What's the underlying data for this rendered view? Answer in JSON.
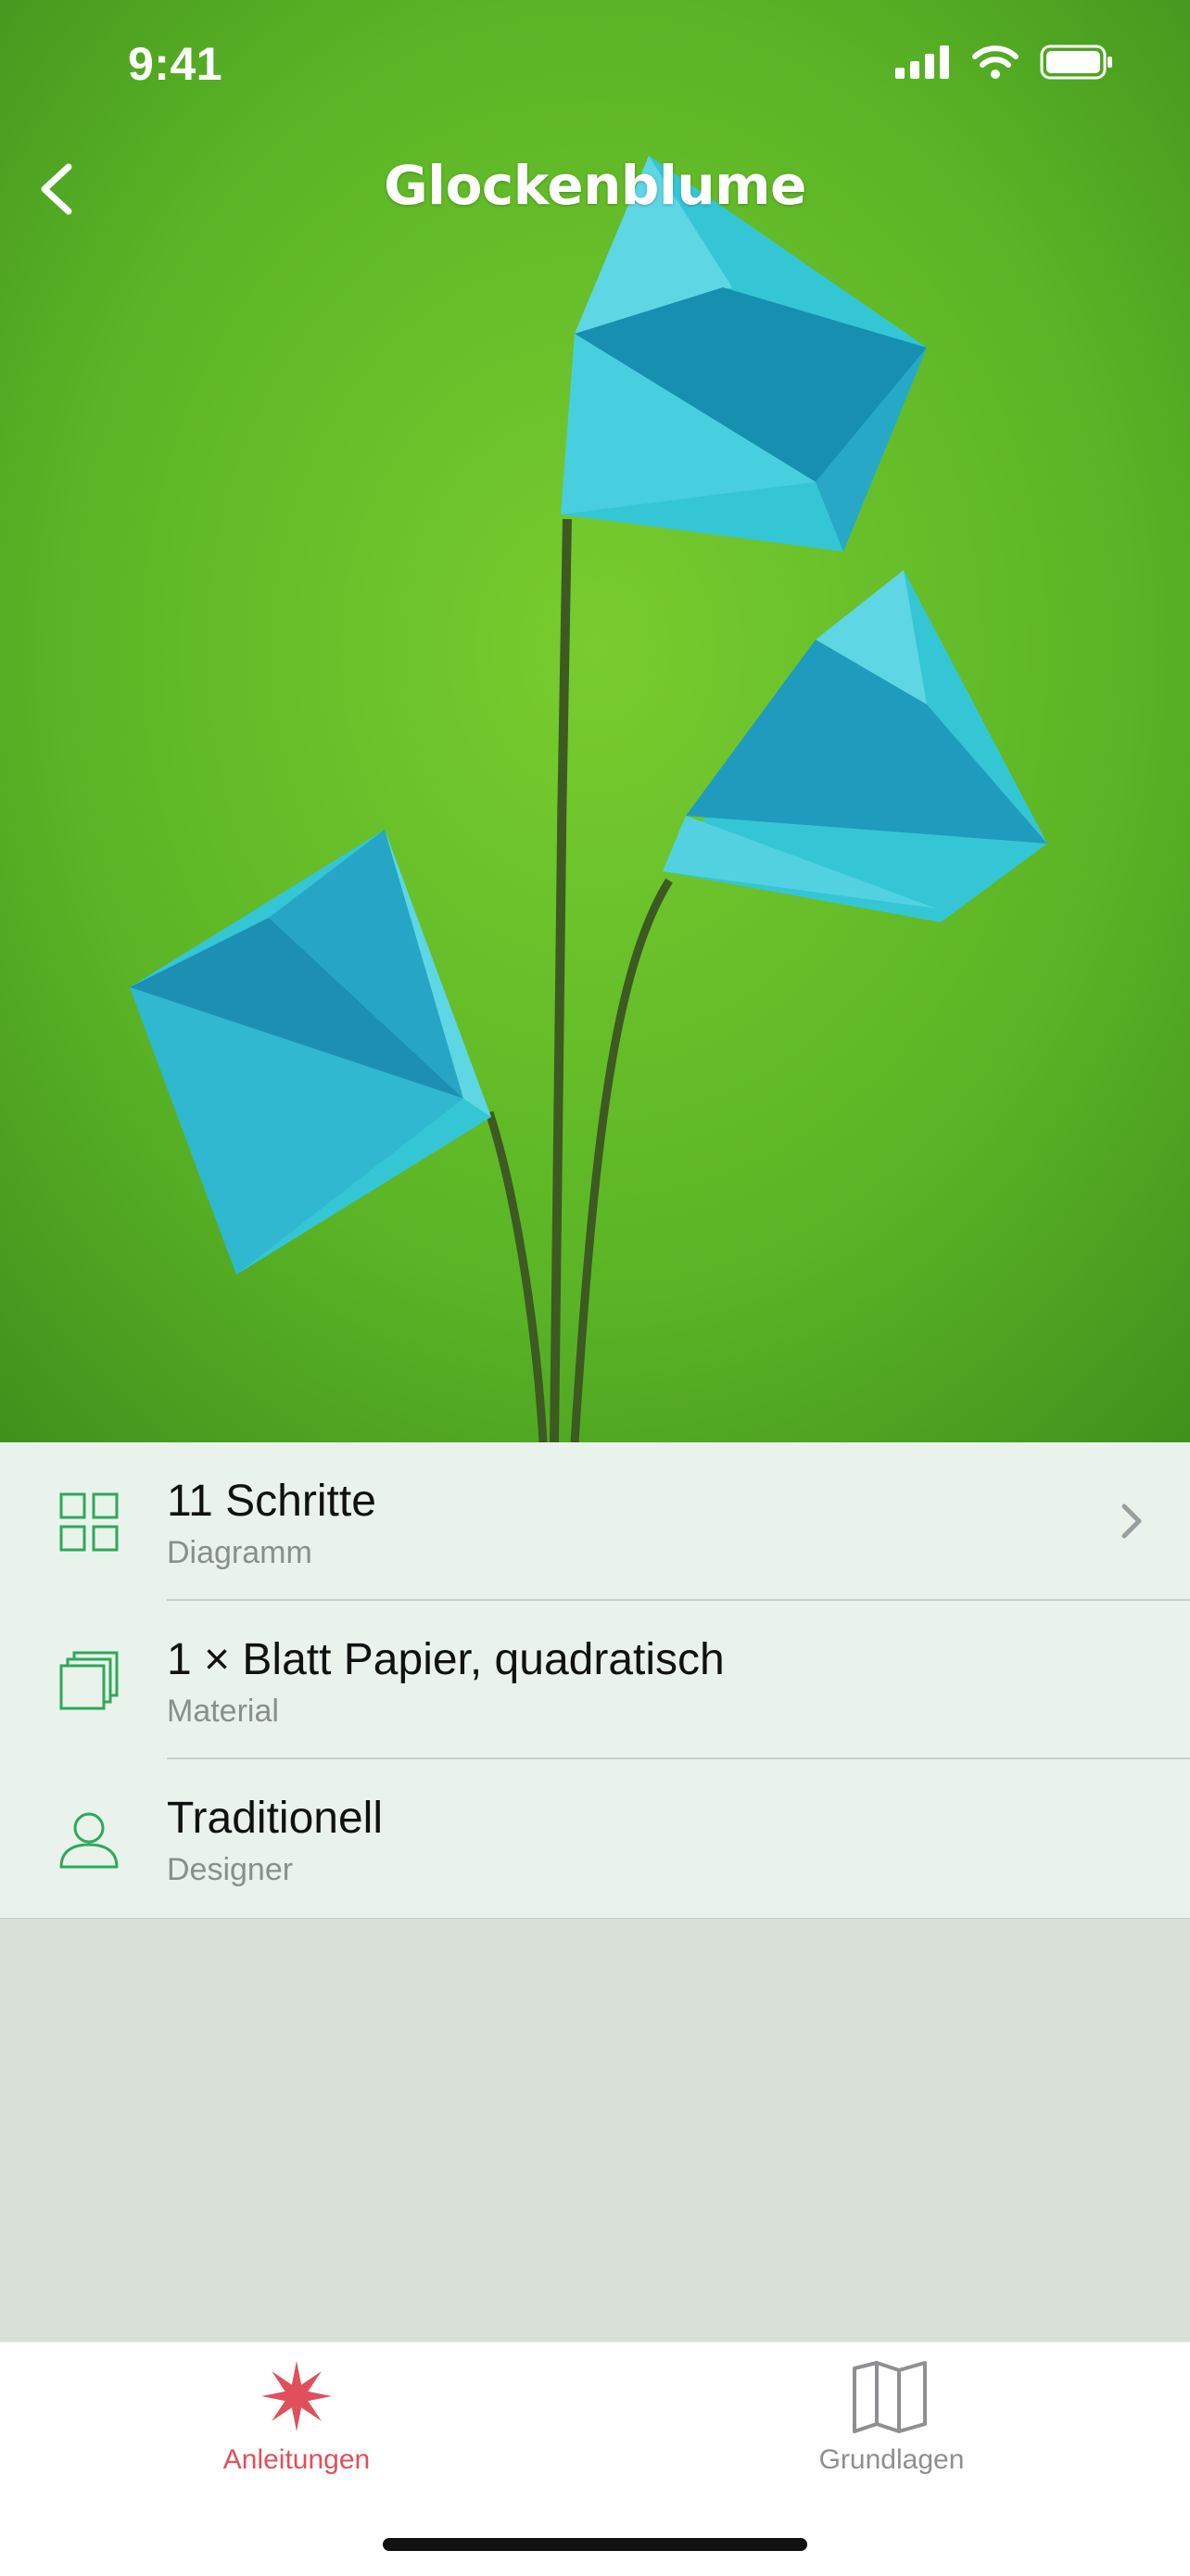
{
  "status_bar": {
    "time": "9:41"
  },
  "nav": {
    "title": "Glockenblume"
  },
  "details": [
    {
      "title": "11 Schritte",
      "subtitle": "Diagramm",
      "icon": "grid-icon"
    },
    {
      "title": "1 × Blatt Papier, quadratisch",
      "subtitle": "Material",
      "icon": "paper-stack-icon"
    },
    {
      "title": "Traditionell",
      "subtitle": "Designer",
      "icon": "person-icon"
    }
  ],
  "tabs": [
    {
      "label": "Anleitungen",
      "icon": "origami-star-icon",
      "active": true
    },
    {
      "label": "Grundlagen",
      "icon": "map-icon",
      "active": false
    }
  ],
  "colors": {
    "accent_green": "#2fa85a",
    "tab_active": "#e0505a",
    "tab_inactive": "#8e8e93",
    "flower": "#2fc4d8",
    "background_green": "#5cb82a"
  }
}
